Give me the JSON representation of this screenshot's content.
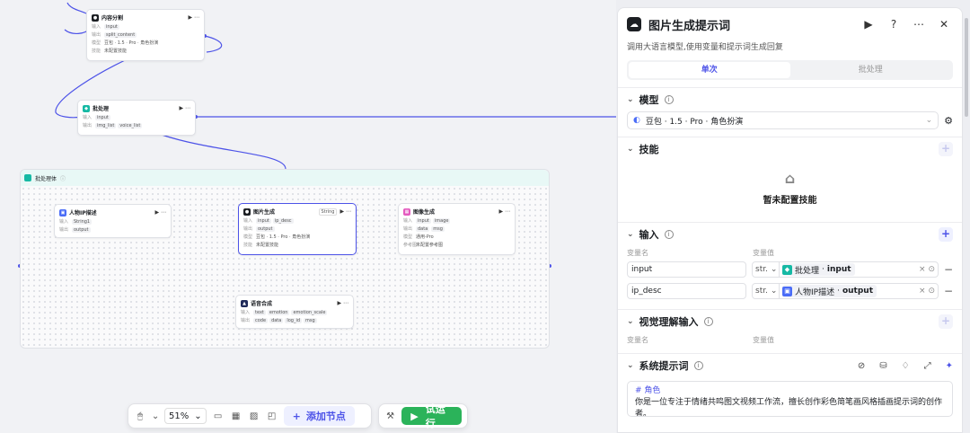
{
  "canvas": {
    "nodes": {
      "content_split": {
        "title": "内容分割",
        "in_label": "输入",
        "in": "input",
        "out_label": "输出",
        "out": "split_content",
        "model_label": "模型",
        "model": "豆包 · 1.5 · Pro · 角色扮演",
        "skill_label": "技能",
        "skill": "未配置技能"
      },
      "batch": {
        "title": "批处理",
        "in_label": "输入",
        "in": "input",
        "out_label": "输出",
        "out1": "img_list",
        "out2": "voice_list"
      },
      "group": {
        "title": "批处理体"
      },
      "ip_desc": {
        "title": "人物IP描述",
        "in_label": "输入",
        "in": "String1",
        "out_label": "输出",
        "out": "output"
      },
      "img_prompt": {
        "title": "图片生成",
        "badge": "String",
        "in_label": "输入",
        "in1": "input",
        "in2": "ip_desc",
        "out_label": "输出",
        "out": "output",
        "model_label": "模型",
        "model": "豆包 · 1.5 · Pro · 角色扮演",
        "skill_label": "技能",
        "skill": "未配置技能"
      },
      "img_gen": {
        "title": "图像生成",
        "in_label": "输入",
        "in1": "input",
        "in2": "image",
        "out_label": "输出",
        "out1": "data",
        "out2": "msg",
        "model_label": "模型",
        "model": "通用-Pro",
        "skill_label": "参考图",
        "skill": "未配置参考图"
      },
      "tts": {
        "title": "语音合成",
        "in_label": "输入",
        "in1": "text",
        "in2": "emotion",
        "in3": "emotion_scale",
        "out_label": "输出",
        "out1": "code",
        "out2": "data",
        "out3": "log_id",
        "out4": "msg"
      }
    },
    "toolbar": {
      "zoom": "51%",
      "add_node": "添加节点",
      "run": "试运行"
    }
  },
  "panel": {
    "title": "图片生成提示词",
    "description": "调用大语言模型,使用变量和提示词生成回复",
    "tabs": [
      "单次",
      "批处理"
    ],
    "model": {
      "label": "模型",
      "value": "豆包 · 1.5 · Pro · 角色扮演"
    },
    "skills": {
      "label": "技能",
      "empty": "暂未配置技能"
    },
    "inputs": {
      "label": "输入",
      "col_name": "变量名",
      "col_value": "变量值",
      "rows": [
        {
          "name": "input",
          "type": "str.",
          "source": "批处理",
          "field": "input",
          "color": "#16b9a4"
        },
        {
          "name": "ip_desc",
          "type": "str.",
          "source": "人物IP描述",
          "field": "output",
          "color": "#4a6cf7"
        }
      ]
    },
    "vision": {
      "label": "视觉理解输入",
      "col_name": "变量名",
      "col_value": "变量值"
    },
    "system_prompt": {
      "label": "系统提示词",
      "heading": "# 角色",
      "body": "你是一位专注于情绪共鸣图文视频工作流，擅长创作彩色简笔画风格插画提示词的创作者。"
    }
  }
}
